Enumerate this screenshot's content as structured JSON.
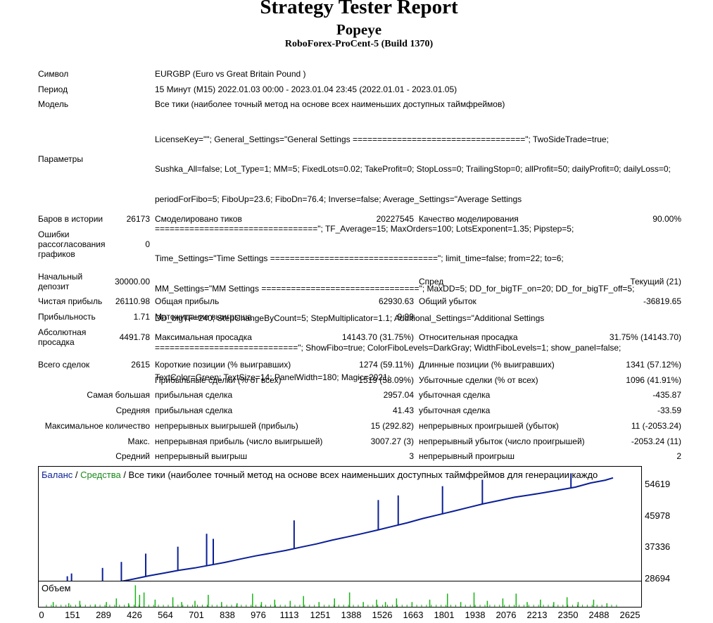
{
  "header": {
    "title": "Strategy Tester Report",
    "ea_name": "Popeye",
    "server": "RoboForex-ProCent-5 (Build 1370)"
  },
  "settings": {
    "symbol_label": "Символ",
    "symbol_value": "EURGBP (Euro vs Great Britain Pound )",
    "period_label": "Период",
    "period_value": "15 Минут (M15) 2022.01.03 00:00 - 2023.01.04 23:45 (2022.01.01 - 2023.01.05)",
    "model_label": "Модель",
    "model_value": "Все тики (наиболее точный метод на основе всех наименьших доступных таймфреймов)",
    "params_label": "Параметры",
    "params_lines": [
      "LicenseKey=\"\"; General_Settings=\"General Settings ===================================\"; TwoSideTrade=true;",
      "Sushka_All=false; Lot_Type=1; MM=5; FixedLots=0.02; TakeProfit=0; StopLoss=0; TrailingStop=0; allProfit=50; dailyProfit=0; dailyLoss=0;",
      "periodForFibo=5; FiboUp=23.6; FiboDn=76.4; Inverse=false; Average_Settings=\"Average Settings",
      "=================================\"; TF_Average=15; MaxOrders=100; LotsExponent=1.35; Pipstep=5;",
      "Time_Settings=\"Time Settings ==================================\"; limit_time=false; from=22; to=6;",
      "MM_Settings=\"MM Settings ================================\"; MaxDD=5; DD_for_bigTF_on=20; DD_for_bigTF_off=5;",
      "DD_bigTF=240; StepChangeByCount=5; StepMultiplicator=1.1; Additional_Settings=\"Additional Settings",
      "=============================\"; ShowFibo=true; ColorFiboLevels=DarkGray; WidthFiboLevels=1; show_panel=false;",
      "TextColor=Green; TextSize=14; PanelWidth=180; Magic=2021;"
    ]
  },
  "stats": {
    "bars_label": "Баров в истории",
    "bars_value": "26173",
    "ticks_label": "Смоделировано тиков",
    "ticks_value": "20227545",
    "quality_label": "Качество моделирования",
    "quality_value": "90.00%",
    "mismatch_label_1": "Ошибки",
    "mismatch_label_2": "рассогласования",
    "mismatch_label_3": "графиков",
    "mismatch_value": "0",
    "deposit_label_1": "Начальный",
    "deposit_label_2": "депозит",
    "deposit_value": "30000.00",
    "spread_label": "Спред",
    "spread_value": "Текущий (21)",
    "net_profit_label": "Чистая прибыль",
    "net_profit_value": "26110.98",
    "gross_profit_label": "Общая прибыль",
    "gross_profit_value": "62930.63",
    "gross_loss_label": "Общий убыток",
    "gross_loss_value": "-36819.65",
    "profit_factor_label": "Прибыльность",
    "profit_factor_value": "1.71",
    "expected_payoff_label": "Матожидание выигрыша",
    "expected_payoff_value": "9.99",
    "abs_dd_label_1": "Абсолютная",
    "abs_dd_label_2": "просадка",
    "abs_dd_value": "4491.78",
    "max_dd_label": "Максимальная просадка",
    "max_dd_value": "14143.70 (31.75%)",
    "rel_dd_label": "Относительная просадка",
    "rel_dd_value": "31.75% (14143.70)",
    "total_trades_label": "Всего сделок",
    "total_trades_value": "2615",
    "short_label": "Короткие позиции (% выигравших)",
    "short_value": "1274 (59.11%)",
    "long_label": "Длинные позиции (% выигравших)",
    "long_value": "1341 (57.12%)",
    "profit_trades_label": "Прибыльные сделки (% от всех)",
    "profit_trades_value": "1519 (58.09%)",
    "loss_trades_label": "Убыточные сделки (% от всех)",
    "loss_trades_value": "1096 (41.91%)",
    "largest_label": "Самая большая",
    "largest_profit_label": "прибыльная сделка",
    "largest_profit_value": "2957.04",
    "largest_loss_label": "убыточная сделка",
    "largest_loss_value": "-435.87",
    "average_label": "Средняя",
    "average_profit_label": "прибыльная сделка",
    "average_profit_value": "41.43",
    "average_loss_label": "убыточная сделка",
    "average_loss_value": "-33.59",
    "max_count_label": "Максимальное количество",
    "consec_wins_label": "непрерывных выигрышей (прибыль)",
    "consec_wins_value": "15 (292.82)",
    "consec_losses_label": "непрерывных проигрышей (убыток)",
    "consec_losses_value": "11 (-2053.24)",
    "max_label": "Макс.",
    "consec_profit_label": "непрерывная прибыль (число выигрышей)",
    "consec_profit_value": "3007.27 (3)",
    "consec_loss_label": "непрерывный убыток (число проигрышей)",
    "consec_loss_value": "-2053.24 (11)",
    "avg_label": "Средний",
    "avg_wins_label": "непрерывный выигрыш",
    "avg_wins_value": "3",
    "avg_losses_label": "непрерывный проигрыш",
    "avg_losses_value": "2"
  },
  "chart_legend": {
    "balance": "Баланс",
    "sep1": " / ",
    "equity": "Средства",
    "sep2": " / ",
    "model": "Все тики (наиболее точный метод на основе всех наименьших доступных таймфреймов для генерации каждо"
  },
  "volume_label": "Объем",
  "colors": {
    "balance": "#0a1f96",
    "equity": "#1a8a1a",
    "volume": "#18b418"
  },
  "chart_data": {
    "type": "line",
    "title": "",
    "xlabel": "",
    "ylabel": "",
    "x_ticks": [
      "0",
      "151",
      "289",
      "426",
      "564",
      "701",
      "838",
      "976",
      "1113",
      "1251",
      "1388",
      "1526",
      "1663",
      "1801",
      "1938",
      "2076",
      "2213",
      "2350",
      "2488",
      "2625"
    ],
    "y_ticks": [
      "54619",
      "45978",
      "37336",
      "28694"
    ],
    "ylim": [
      28694,
      57500
    ],
    "xlim": [
      0,
      2625
    ],
    "series": [
      {
        "role": "balance",
        "x": [
          0,
          75,
          151,
          220,
          289,
          360,
          426,
          495,
          564,
          630,
          701,
          770,
          838,
          905,
          976,
          1045,
          1113,
          1180,
          1251,
          1320,
          1388,
          1455,
          1526,
          1595,
          1663,
          1730,
          1801,
          1870,
          1938,
          2005,
          2076,
          2145,
          2213,
          2280,
          2350,
          2420,
          2488,
          2555,
          2590
        ],
        "y": [
          30000,
          30600,
          31600,
          32300,
          32900,
          33500,
          34100,
          34800,
          35400,
          36000,
          36500,
          37100,
          37700,
          38400,
          39100,
          39700,
          40300,
          41000,
          41700,
          42500,
          43200,
          43900,
          44700,
          45500,
          46300,
          47200,
          48000,
          48800,
          49600,
          50400,
          51100,
          51800,
          52300,
          52800,
          53400,
          54000,
          54900,
          55500,
          56000
        ]
      }
    ],
    "spikes": [
      {
        "x": 126,
        "y": 34700
      },
      {
        "x": 145,
        "y": 35300
      },
      {
        "x": 285,
        "y": 36500
      },
      {
        "x": 370,
        "y": 37800
      },
      {
        "x": 480,
        "y": 39600
      },
      {
        "x": 625,
        "y": 41100
      },
      {
        "x": 755,
        "y": 43900
      },
      {
        "x": 785,
        "y": 42800
      },
      {
        "x": 1150,
        "y": 46800
      },
      {
        "x": 1530,
        "y": 51200
      },
      {
        "x": 1620,
        "y": 52200
      },
      {
        "x": 1820,
        "y": 54200
      },
      {
        "x": 2000,
        "y": 55600
      },
      {
        "x": 2400,
        "y": 57000
      }
    ],
    "volume": [
      {
        "x": 60,
        "v": 0.2
      },
      {
        "x": 130,
        "v": 0.15
      },
      {
        "x": 180,
        "v": 0.25
      },
      {
        "x": 250,
        "v": 0.1
      },
      {
        "x": 300,
        "v": 0.2
      },
      {
        "x": 345,
        "v": 0.35
      },
      {
        "x": 400,
        "v": 0.15
      },
      {
        "x": 431,
        "v": 0.9
      },
      {
        "x": 450,
        "v": 0.5
      },
      {
        "x": 470,
        "v": 0.6
      },
      {
        "x": 520,
        "v": 0.3
      },
      {
        "x": 600,
        "v": 0.4
      },
      {
        "x": 640,
        "v": 0.2
      },
      {
        "x": 700,
        "v": 0.25
      },
      {
        "x": 760,
        "v": 0.5
      },
      {
        "x": 820,
        "v": 0.2
      },
      {
        "x": 890,
        "v": 0.15
      },
      {
        "x": 960,
        "v": 0.55
      },
      {
        "x": 1000,
        "v": 0.2
      },
      {
        "x": 1060,
        "v": 0.3
      },
      {
        "x": 1130,
        "v": 0.25
      },
      {
        "x": 1190,
        "v": 0.45
      },
      {
        "x": 1260,
        "v": 0.2
      },
      {
        "x": 1330,
        "v": 0.35
      },
      {
        "x": 1398,
        "v": 0.6
      },
      {
        "x": 1460,
        "v": 0.2
      },
      {
        "x": 1520,
        "v": 0.3
      },
      {
        "x": 1560,
        "v": 0.2
      },
      {
        "x": 1610,
        "v": 0.35
      },
      {
        "x": 1680,
        "v": 0.2
      },
      {
        "x": 1760,
        "v": 0.3
      },
      {
        "x": 1840,
        "v": 0.55
      },
      {
        "x": 1900,
        "v": 0.2
      },
      {
        "x": 1960,
        "v": 0.6
      },
      {
        "x": 2020,
        "v": 0.25
      },
      {
        "x": 2090,
        "v": 0.35
      },
      {
        "x": 2150,
        "v": 0.55
      },
      {
        "x": 2200,
        "v": 0.2
      },
      {
        "x": 2260,
        "v": 0.3
      },
      {
        "x": 2320,
        "v": 0.2
      },
      {
        "x": 2380,
        "v": 0.4
      },
      {
        "x": 2430,
        "v": 0.2
      },
      {
        "x": 2500,
        "v": 0.3
      },
      {
        "x": 2560,
        "v": 0.15
      }
    ]
  }
}
